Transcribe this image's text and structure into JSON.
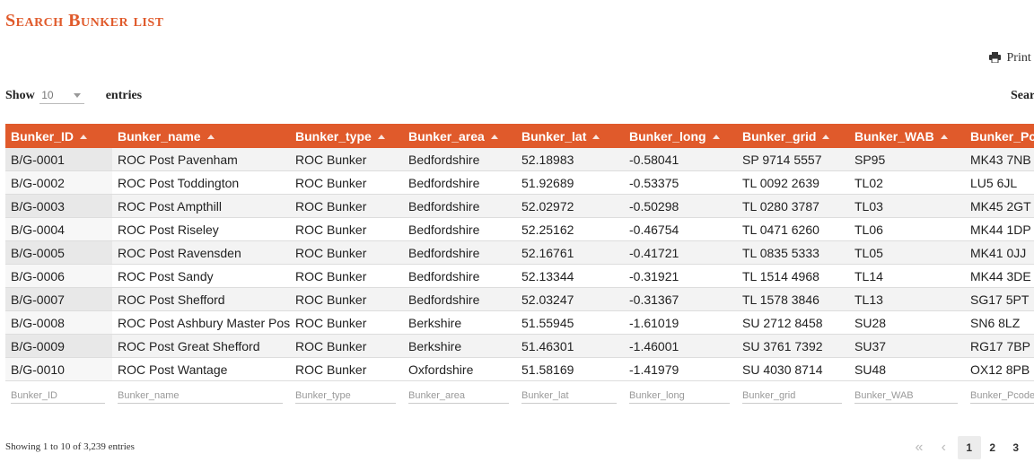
{
  "page": {
    "title": "Search Bunker list"
  },
  "toolbar": {
    "print_label": "Print"
  },
  "length": {
    "show_label": "Show",
    "value": "10",
    "entries_label": "entries"
  },
  "search": {
    "label": "Sear"
  },
  "table": {
    "columns": [
      "Bunker_ID",
      "Bunker_name",
      "Bunker_type",
      "Bunker_area",
      "Bunker_lat",
      "Bunker_long",
      "Bunker_grid",
      "Bunker_WAB",
      "Bunker_Pcode"
    ],
    "rows": [
      [
        "B/G-0001",
        "ROC Post Pavenham",
        "ROC Bunker",
        "Bedfordshire",
        "52.18983",
        "-0.58041",
        "SP 9714 5557",
        "SP95",
        "MK43 7NB"
      ],
      [
        "B/G-0002",
        "ROC Post Toddington",
        "ROC Bunker",
        "Bedfordshire",
        "51.92689",
        "-0.53375",
        "TL 0092 2639",
        "TL02",
        "LU5 6JL"
      ],
      [
        "B/G-0003",
        "ROC Post Ampthill",
        "ROC Bunker",
        "Bedfordshire",
        "52.02972",
        "-0.50298",
        "TL 0280 3787",
        "TL03",
        "MK45 2GT"
      ],
      [
        "B/G-0004",
        "ROC Post Riseley",
        "ROC Bunker",
        "Bedfordshire",
        "52.25162",
        "-0.46754",
        "TL 0471 6260",
        "TL06",
        "MK44 1DP"
      ],
      [
        "B/G-0005",
        "ROC Post Ravensden",
        "ROC Bunker",
        "Bedfordshire",
        "52.16761",
        "-0.41721",
        "TL 0835 5333",
        "TL05",
        "MK41 0JJ"
      ],
      [
        "B/G-0006",
        "ROC Post Sandy",
        "ROC Bunker",
        "Bedfordshire",
        "52.13344",
        "-0.31921",
        "TL 1514 4968",
        "TL14",
        "MK44 3DE"
      ],
      [
        "B/G-0007",
        "ROC Post Shefford",
        "ROC Bunker",
        "Bedfordshire",
        "52.03247",
        "-0.31367",
        "TL 1578 3846",
        "TL13",
        "SG17 5PT"
      ],
      [
        "B/G-0008",
        "ROC Post Ashbury Master Post",
        "ROC Bunker",
        "Berkshire",
        "51.55945",
        "-1.61019",
        "SU 2712 8458",
        "SU28",
        "SN6 8LZ"
      ],
      [
        "B/G-0009",
        "ROC Post Great Shefford",
        "ROC Bunker",
        "Berkshire",
        "51.46301",
        "-1.46001",
        "SU 3761 7392",
        "SU37",
        "RG17 7BP"
      ],
      [
        "B/G-0010",
        "ROC Post Wantage",
        "ROC Bunker",
        "Oxfordshire",
        "51.58169",
        "-1.41979",
        "SU 4030 8714",
        "SU48",
        "OX12 8PB"
      ]
    ],
    "filter_placeholders": [
      "Bunker_ID",
      "Bunker_name",
      "Bunker_type",
      "Bunker_area",
      "Bunker_lat",
      "Bunker_long",
      "Bunker_grid",
      "Bunker_WAB",
      "Bunker_Pcode"
    ]
  },
  "footer": {
    "info": "Showing 1 to 10 of 3,239 entries"
  },
  "pagination": {
    "first": "«",
    "prev": "‹",
    "pages": [
      "1",
      "2",
      "3"
    ],
    "active_page": "1"
  },
  "colors": {
    "accent": "#e05a2b"
  },
  "icons": {
    "print": "printer-icon",
    "sort": "sort-asc-icon"
  }
}
